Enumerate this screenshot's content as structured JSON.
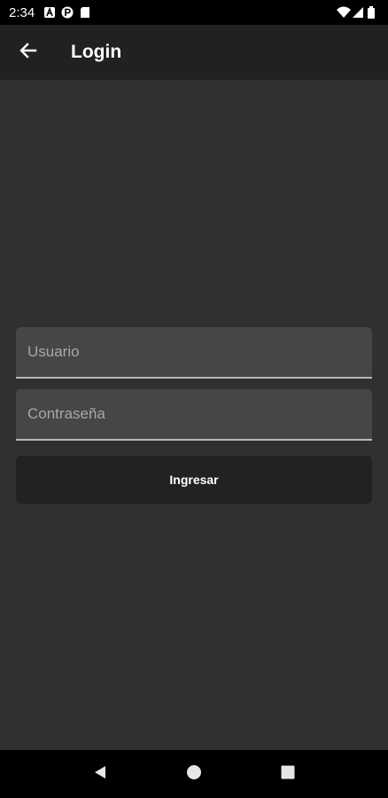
{
  "status_bar": {
    "time": "2:34",
    "left_icons": [
      "a-notification-icon",
      "p-notification-icon",
      "sd-card-icon"
    ],
    "right_icons": [
      "wifi-icon",
      "signal-icon",
      "battery-icon"
    ]
  },
  "app_bar": {
    "title": "Login",
    "back_icon": "arrow-back-icon"
  },
  "form": {
    "username_placeholder": "Usuario",
    "password_placeholder": "Contraseña",
    "submit_label": "Ingresar"
  },
  "nav_bar": {
    "buttons": [
      "back-triangle-icon",
      "home-circle-icon",
      "recents-square-icon"
    ]
  },
  "colors": {
    "background": "#303030",
    "app_bar": "#212121",
    "field": "#464646",
    "button": "#222222",
    "text": "#ffffff",
    "placeholder": "#a8a8a8"
  }
}
